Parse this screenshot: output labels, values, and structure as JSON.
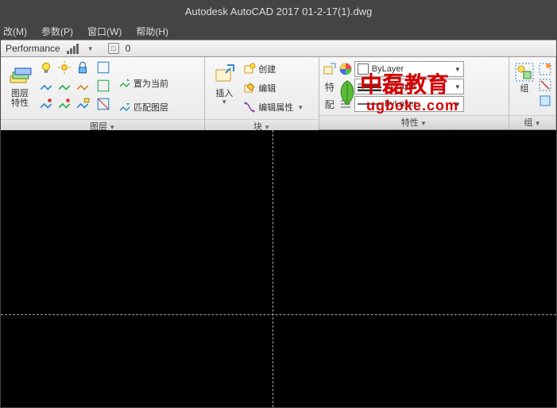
{
  "title": "Autodesk AutoCAD 2017     01-2-17(1).dwg",
  "menu": {
    "modify": "改(M)",
    "param": "参数(P)",
    "window": "窗口(W)",
    "help": "帮助(H)"
  },
  "perf": {
    "label": "Performance",
    "value": "0"
  },
  "panels": {
    "layer": {
      "title": "图层",
      "big": "图层\n特性",
      "set_current": "置为当前",
      "match": "匹配图层"
    },
    "block": {
      "title": "块",
      "insert": "插入",
      "create": "创建",
      "edit": "编辑",
      "editattr": "编辑属性"
    },
    "props": {
      "title": "特性",
      "bylayer1": "ByLayer",
      "bylayer2": "ByLayer",
      "bylayer3": "ByLayer"
    },
    "group": {
      "title": "组",
      "label": "组"
    }
  },
  "watermark": {
    "line1": "中磊教育",
    "line2": "ugboke.com"
  }
}
